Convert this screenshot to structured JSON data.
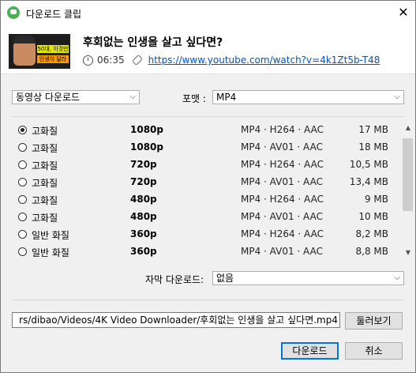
{
  "window": {
    "title": "다운로드 클립",
    "close_glyph": "✕"
  },
  "video": {
    "title": "후회없는 인생을 살고 싶다면?",
    "duration": "06:35",
    "url": "https://www.youtube.com/watch?v=4k1Zt5b-T48",
    "thumb_text1": "50대, 이것만 알아도",
    "thumb_text2": "인생이 달라진다"
  },
  "download_type": {
    "value": "동영상 다운로드"
  },
  "format": {
    "label": "포맷 :",
    "value": "MP4"
  },
  "options": [
    {
      "quality": "고화질",
      "resolution": "1080p",
      "codec": "MP4 · H264 · AAC",
      "size": "17 MB",
      "selected": true
    },
    {
      "quality": "고화질",
      "resolution": "1080p",
      "codec": "MP4 · AV01 · AAC",
      "size": "18 MB",
      "selected": false
    },
    {
      "quality": "고화질",
      "resolution": "720p",
      "codec": "MP4 · H264 · AAC",
      "size": "10,5 MB",
      "selected": false
    },
    {
      "quality": "고화질",
      "resolution": "720p",
      "codec": "MP4 · AV01 · AAC",
      "size": "13,4 MB",
      "selected": false
    },
    {
      "quality": "고화질",
      "resolution": "480p",
      "codec": "MP4 · H264 · AAC",
      "size": "9 MB",
      "selected": false
    },
    {
      "quality": "고화질",
      "resolution": "480p",
      "codec": "MP4 · AV01 · AAC",
      "size": "10 MB",
      "selected": false
    },
    {
      "quality": "일반 화질",
      "resolution": "360p",
      "codec": "MP4 · H264 · AAC",
      "size": "8,2 MB",
      "selected": false
    },
    {
      "quality": "일반 화질",
      "resolution": "360p",
      "codec": "MP4 · AV01 · AAC",
      "size": "8,8 MB",
      "selected": false
    }
  ],
  "subtitles": {
    "label": "자막 다운로드:",
    "value": "없음"
  },
  "save_path": {
    "value": "rs/dibao/Videos/4K Video Downloader/후회없는 인생을 살고 싶다면.mp4"
  },
  "buttons": {
    "browse": "둘러보기",
    "download": "다운로드",
    "cancel": "취소"
  },
  "icons": {
    "app": "app-logo-icon",
    "clock": "clock-icon",
    "link": "link-icon",
    "chevron": "chevron-down-icon"
  },
  "colors": {
    "link": "#0055cc",
    "accent": "#0078d7",
    "app_icon": "#4caf50"
  }
}
